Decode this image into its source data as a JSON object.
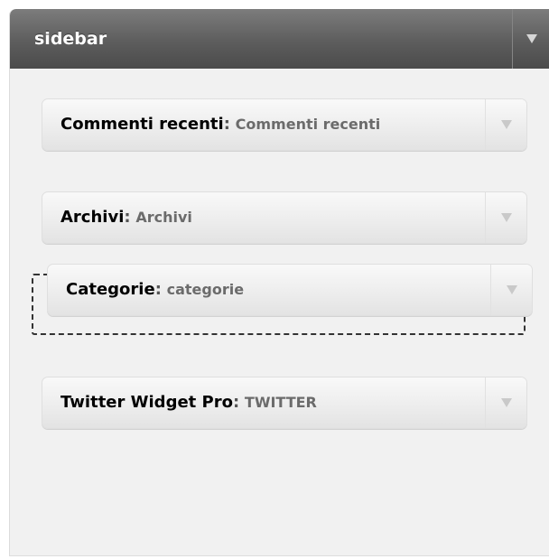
{
  "sidebar": {
    "title": "sidebar",
    "toggle_icon": "triangle-down-icon"
  },
  "widgets": [
    {
      "name": "Commenti recenti",
      "separator": ":",
      "instance_title": "Commenti recenti",
      "toggle_icon": "triangle-down-icon",
      "state": "default"
    },
    {
      "name": "Archivi",
      "separator": ":",
      "instance_title": "Archivi",
      "toggle_icon": "triangle-down-icon",
      "state": "default"
    },
    {
      "name": "Categorie",
      "separator": ":",
      "instance_title": "categorie",
      "toggle_icon": "triangle-down-icon",
      "state": "dragging"
    },
    {
      "name": "Twitter Widget Pro",
      "separator": ":",
      "instance_title": "TWITTER",
      "toggle_icon": "triangle-down-icon",
      "state": "default"
    }
  ],
  "colors": {
    "header": "#5d5d5d",
    "panel_background": "#f1f1f1",
    "widget_background": "#ececec",
    "instance_title_text": "#6b6b6b",
    "placeholder_border": "#333333"
  }
}
